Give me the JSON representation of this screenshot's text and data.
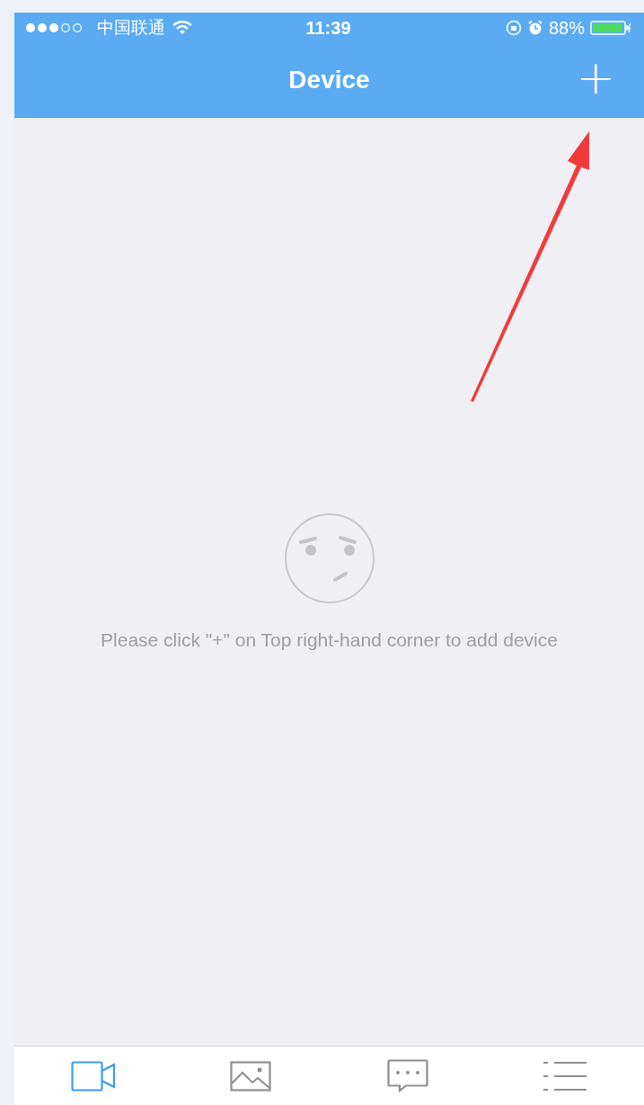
{
  "status_bar": {
    "carrier": "中国联通",
    "time": "11:39",
    "battery": "88%"
  },
  "nav_bar": {
    "title": "Device",
    "action": "+"
  },
  "empty_state": {
    "message": "Please click \"+\" on Top right-hand corner to add device"
  },
  "tab_bar": [
    {
      "kind": "camera",
      "selected": true
    },
    {
      "kind": "gallery",
      "selected": false
    },
    {
      "kind": "messages",
      "selected": false
    },
    {
      "kind": "list",
      "selected": false
    }
  ]
}
